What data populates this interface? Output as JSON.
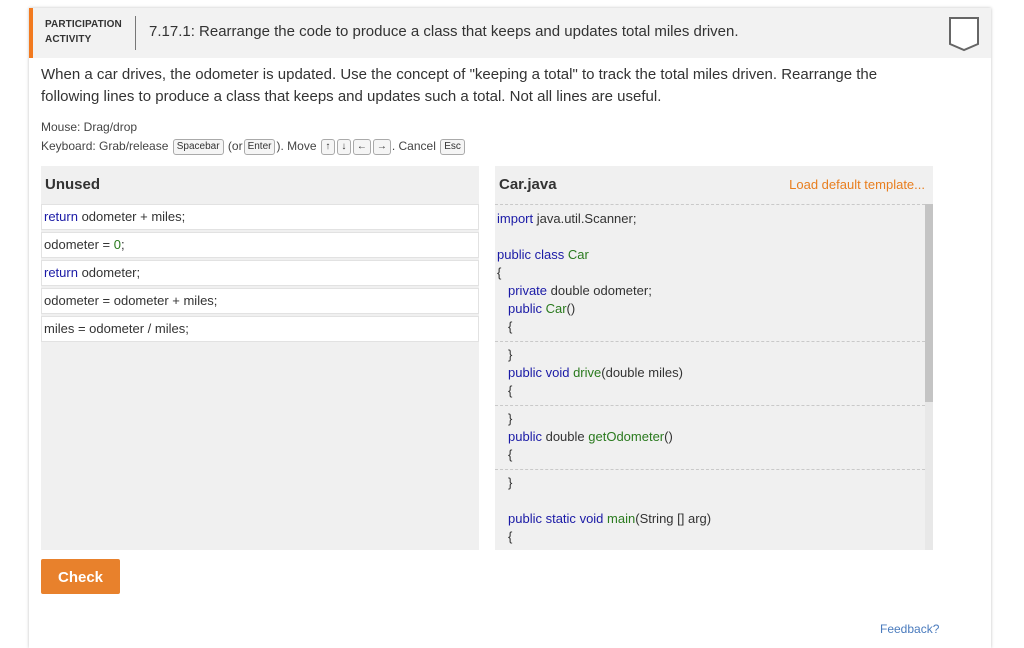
{
  "header": {
    "label": "PARTICIPATION ACTIVITY",
    "title": "7.17.1: Rearrange the code to produce a class that keeps and updates total miles driven."
  },
  "instructions": "When a car drives, the odometer is updated. Use the concept of \"keeping a total\" to track the total miles driven. Rearrange the following lines to produce a class that keeps and updates such a total. Not all lines are useful.",
  "help": {
    "mouse": "Mouse: Drag/drop",
    "keyboard_prefix": "Keyboard: Grab/release",
    "spacebar": "Spacebar",
    "or_open": "(or",
    "enter": "Enter",
    "close_move": "). Move",
    "up": "↑",
    "down": "↓",
    "left": "←",
    "right": "→",
    "cancel": ". Cancel",
    "esc": "Esc"
  },
  "unused": {
    "title": "Unused",
    "items": [
      {
        "kw": "return",
        "rest": " odometer + miles;"
      },
      {
        "kw": "",
        "rest": "odometer = ",
        "num": "0",
        "end": ";"
      },
      {
        "kw": "return",
        "rest": " odometer;"
      },
      {
        "kw": "",
        "rest": "odometer = odometer + miles;"
      },
      {
        "kw": "",
        "rest": "miles = odometer / miles;"
      }
    ]
  },
  "code": {
    "title": "Car.java",
    "load_template": "Load default template...",
    "lines": {
      "import_kw": "import",
      "import_rest": " java.util.Scanner;",
      "public": "public",
      "class": "class",
      "car": "Car",
      "brace_open": "{",
      "brace_close": "}",
      "private": "private",
      "double_odometer": " double odometer;",
      "car_ctor": "Car",
      "parens": "()",
      "void": "void",
      "drive": "drive",
      "drive_params": "(double miles)",
      "double": "double",
      "getOdometer": "getOdometer",
      "static": "static",
      "main": "main",
      "main_params": "(String [] arg)"
    }
  },
  "check_label": "Check",
  "feedback_label": "Feedback?",
  "colors": {
    "accent": "#f27a1f",
    "button": "#e8812c",
    "keyword": "#1a1aa6",
    "type": "#2a7a1e"
  }
}
